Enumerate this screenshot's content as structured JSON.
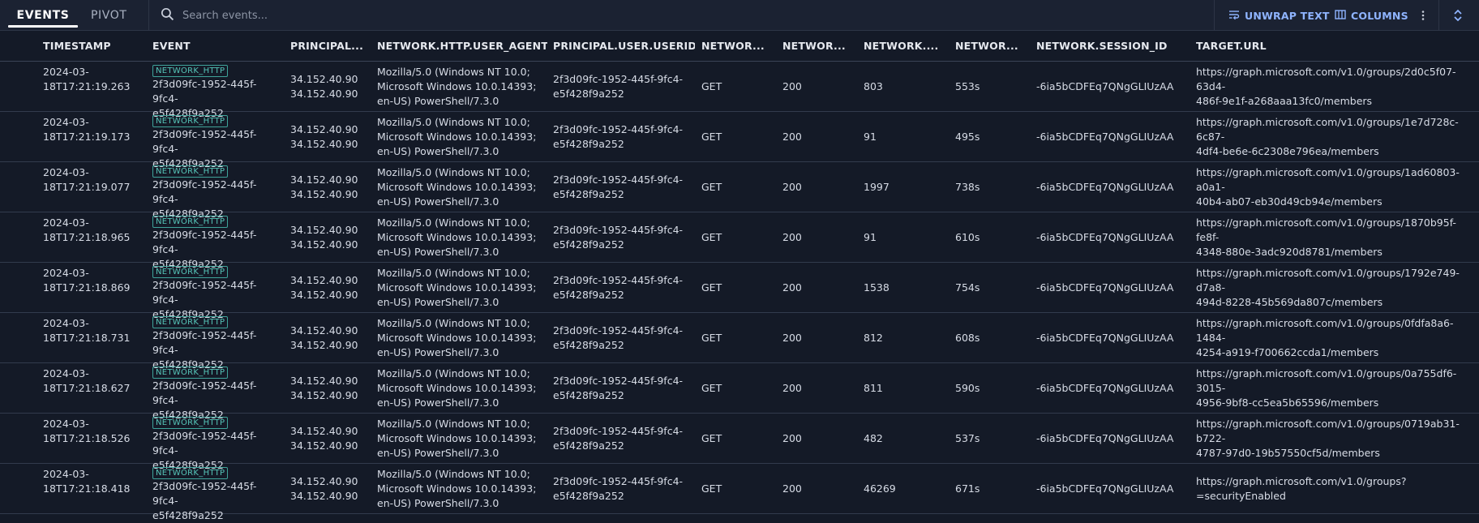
{
  "tabs": {
    "events": "EVENTS",
    "pivot": "PIVOT"
  },
  "search": {
    "placeholder": "Search events..."
  },
  "toolbar": {
    "unwrap_label": "UNWRAP TEXT",
    "columns_label": "COLUMNS"
  },
  "columns": {
    "timestamp": "TIMESTAMP",
    "event": "EVENT",
    "principal_ip": "PRINCIPAL...",
    "user_agent": "NETWORK.HTTP.USER_AGENT",
    "userid": "PRINCIPAL.USER.USERID",
    "method": "NETWOR...",
    "response_code": "NETWOR...",
    "bytes": "NETWORK....",
    "duration": "NETWOR...",
    "session_id": "NETWORK.SESSION_ID",
    "target_url": "TARGET.URL"
  },
  "rows": [
    {
      "timestamp": "2024-03-\n18T17:21:19.263",
      "event_type": "NETWORK_HTTP",
      "event_id": "2f3d09fc-1952-445f-9fc4-\ne5f428f9a252",
      "ip": "34.152.40.90\n34.152.40.90",
      "user_agent": "Mozilla/5.0 (Windows NT 10.0;\nMicrosoft Windows 10.0.14393;\nen-US) PowerShell/7.3.0",
      "userid": "2f3d09fc-1952-445f-9fc4-\ne5f428f9a252",
      "method": "GET",
      "response_code": "200",
      "bytes": "803",
      "duration": "553s",
      "session_id": "-6ia5bCDFEq7QNgGLIUzAA",
      "target_url": "https://graph.microsoft.com/v1.0/groups/2d0c5f07-63d4-\n486f-9e1f-a268aaa13fc0/members"
    },
    {
      "timestamp": "2024-03-\n18T17:21:19.173",
      "event_type": "NETWORK_HTTP",
      "event_id": "2f3d09fc-1952-445f-9fc4-\ne5f428f9a252",
      "ip": "34.152.40.90\n34.152.40.90",
      "user_agent": "Mozilla/5.0 (Windows NT 10.0;\nMicrosoft Windows 10.0.14393;\nen-US) PowerShell/7.3.0",
      "userid": "2f3d09fc-1952-445f-9fc4-\ne5f428f9a252",
      "method": "GET",
      "response_code": "200",
      "bytes": "91",
      "duration": "495s",
      "session_id": "-6ia5bCDFEq7QNgGLIUzAA",
      "target_url": "https://graph.microsoft.com/v1.0/groups/1e7d728c-6c87-\n4df4-be6e-6c2308e796ea/members"
    },
    {
      "timestamp": "2024-03-\n18T17:21:19.077",
      "event_type": "NETWORK_HTTP",
      "event_id": "2f3d09fc-1952-445f-9fc4-\ne5f428f9a252",
      "ip": "34.152.40.90\n34.152.40.90",
      "user_agent": "Mozilla/5.0 (Windows NT 10.0;\nMicrosoft Windows 10.0.14393;\nen-US) PowerShell/7.3.0",
      "userid": "2f3d09fc-1952-445f-9fc4-\ne5f428f9a252",
      "method": "GET",
      "response_code": "200",
      "bytes": "1997",
      "duration": "738s",
      "session_id": "-6ia5bCDFEq7QNgGLIUzAA",
      "target_url": "https://graph.microsoft.com/v1.0/groups/1ad60803-a0a1-\n40b4-ab07-eb30d49cb94e/members"
    },
    {
      "timestamp": "2024-03-\n18T17:21:18.965",
      "event_type": "NETWORK_HTTP",
      "event_id": "2f3d09fc-1952-445f-9fc4-\ne5f428f9a252",
      "ip": "34.152.40.90\n34.152.40.90",
      "user_agent": "Mozilla/5.0 (Windows NT 10.0;\nMicrosoft Windows 10.0.14393;\nen-US) PowerShell/7.3.0",
      "userid": "2f3d09fc-1952-445f-9fc4-\ne5f428f9a252",
      "method": "GET",
      "response_code": "200",
      "bytes": "91",
      "duration": "610s",
      "session_id": "-6ia5bCDFEq7QNgGLIUzAA",
      "target_url": "https://graph.microsoft.com/v1.0/groups/1870b95f-fe8f-\n4348-880e-3adc920d8781/members"
    },
    {
      "timestamp": "2024-03-\n18T17:21:18.869",
      "event_type": "NETWORK_HTTP",
      "event_id": "2f3d09fc-1952-445f-9fc4-\ne5f428f9a252",
      "ip": "34.152.40.90\n34.152.40.90",
      "user_agent": "Mozilla/5.0 (Windows NT 10.0;\nMicrosoft Windows 10.0.14393;\nen-US) PowerShell/7.3.0",
      "userid": "2f3d09fc-1952-445f-9fc4-\ne5f428f9a252",
      "method": "GET",
      "response_code": "200",
      "bytes": "1538",
      "duration": "754s",
      "session_id": "-6ia5bCDFEq7QNgGLIUzAA",
      "target_url": "https://graph.microsoft.com/v1.0/groups/1792e749-d7a8-\n494d-8228-45b569da807c/members"
    },
    {
      "timestamp": "2024-03-\n18T17:21:18.731",
      "event_type": "NETWORK_HTTP",
      "event_id": "2f3d09fc-1952-445f-9fc4-\ne5f428f9a252",
      "ip": "34.152.40.90\n34.152.40.90",
      "user_agent": "Mozilla/5.0 (Windows NT 10.0;\nMicrosoft Windows 10.0.14393;\nen-US) PowerShell/7.3.0",
      "userid": "2f3d09fc-1952-445f-9fc4-\ne5f428f9a252",
      "method": "GET",
      "response_code": "200",
      "bytes": "812",
      "duration": "608s",
      "session_id": "-6ia5bCDFEq7QNgGLIUzAA",
      "target_url": "https://graph.microsoft.com/v1.0/groups/0fdfa8a6-1484-\n4254-a919-f700662ccda1/members"
    },
    {
      "timestamp": "2024-03-\n18T17:21:18.627",
      "event_type": "NETWORK_HTTP",
      "event_id": "2f3d09fc-1952-445f-9fc4-\ne5f428f9a252",
      "ip": "34.152.40.90\n34.152.40.90",
      "user_agent": "Mozilla/5.0 (Windows NT 10.0;\nMicrosoft Windows 10.0.14393;\nen-US) PowerShell/7.3.0",
      "userid": "2f3d09fc-1952-445f-9fc4-\ne5f428f9a252",
      "method": "GET",
      "response_code": "200",
      "bytes": "811",
      "duration": "590s",
      "session_id": "-6ia5bCDFEq7QNgGLIUzAA",
      "target_url": "https://graph.microsoft.com/v1.0/groups/0a755df6-3015-\n4956-9bf8-cc5ea5b65596/members"
    },
    {
      "timestamp": "2024-03-\n18T17:21:18.526",
      "event_type": "NETWORK_HTTP",
      "event_id": "2f3d09fc-1952-445f-9fc4-\ne5f428f9a252",
      "ip": "34.152.40.90\n34.152.40.90",
      "user_agent": "Mozilla/5.0 (Windows NT 10.0;\nMicrosoft Windows 10.0.14393;\nen-US) PowerShell/7.3.0",
      "userid": "2f3d09fc-1952-445f-9fc4-\ne5f428f9a252",
      "method": "GET",
      "response_code": "200",
      "bytes": "482",
      "duration": "537s",
      "session_id": "-6ia5bCDFEq7QNgGLIUzAA",
      "target_url": "https://graph.microsoft.com/v1.0/groups/0719ab31-b722-\n4787-97d0-19b57550cf5d/members"
    },
    {
      "timestamp": "2024-03-\n18T17:21:18.418",
      "event_type": "NETWORK_HTTP",
      "event_id": "2f3d09fc-1952-445f-9fc4-\ne5f428f9a252",
      "ip": "34.152.40.90\n34.152.40.90",
      "user_agent": "Mozilla/5.0 (Windows NT 10.0;\nMicrosoft Windows 10.0.14393;\nen-US) PowerShell/7.3.0",
      "userid": "2f3d09fc-1952-445f-9fc4-\ne5f428f9a252",
      "method": "GET",
      "response_code": "200",
      "bytes": "46269",
      "duration": "671s",
      "session_id": "-6ia5bCDFEq7QNgGLIUzAA",
      "target_url": "https://graph.microsoft.com/v1.0/groups?=securityEnabled"
    }
  ]
}
